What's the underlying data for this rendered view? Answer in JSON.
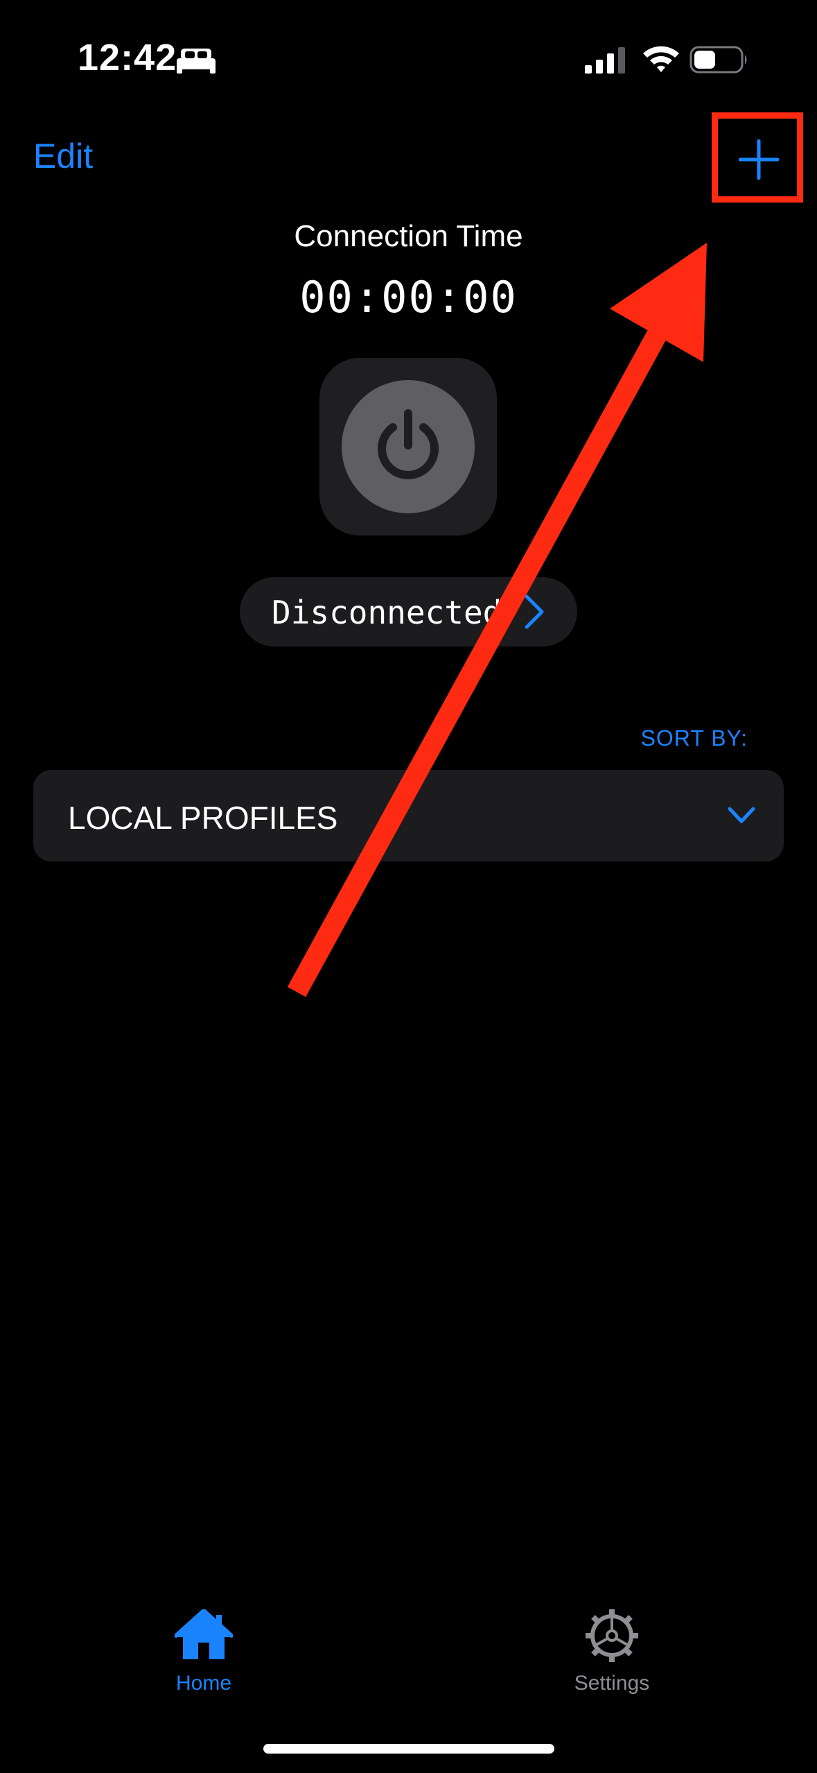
{
  "status_bar": {
    "time": "12:42"
  },
  "nav": {
    "edit_label": "Edit"
  },
  "connection": {
    "title": "Connection Time",
    "elapsed": "00:00:00",
    "status": "Disconnected"
  },
  "sort": {
    "label": "SORT BY:"
  },
  "profiles": {
    "section_label": "LOCAL PROFILES"
  },
  "tabs": [
    {
      "label": "Home",
      "icon": "house-icon",
      "selected": true
    },
    {
      "label": "Settings",
      "icon": "gear-icon",
      "selected": false
    }
  ],
  "colors": {
    "background": "#000000",
    "accent": "#1a84ff",
    "annotation": "#ff2a12",
    "surface": "#1c1c1e",
    "inactive": "#8e8e93"
  }
}
